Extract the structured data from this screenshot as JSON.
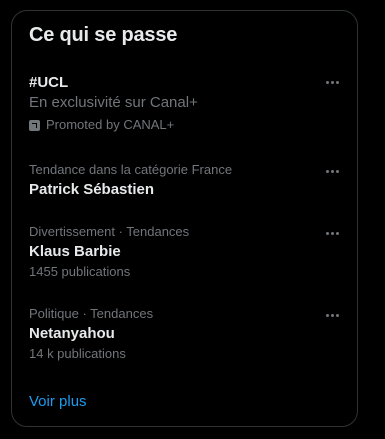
{
  "panel": {
    "title": "Ce qui se passe",
    "show_more": "Voir plus"
  },
  "trends": [
    {
      "name": "#UCL",
      "subtitle": "En exclusivité sur Canal+",
      "promoted": "Promoted by CANAL+"
    },
    {
      "context": "Tendance dans la catégorie France",
      "name": "Patrick Sébastien"
    },
    {
      "context": "Divertissement · Tendances",
      "name": "Klaus Barbie",
      "count": "1455 publications"
    },
    {
      "context": "Politique · Tendances",
      "name": "Netanyahou",
      "count": "14 k publications"
    }
  ],
  "colors": {
    "background": "#000000",
    "border": "#2f3336",
    "primary_text": "#e7e9ea",
    "secondary_text": "#71767b",
    "link": "#1d9bf0"
  },
  "icons": {
    "more": "more-horizontal-icon",
    "promoted": "promoted-icon"
  }
}
